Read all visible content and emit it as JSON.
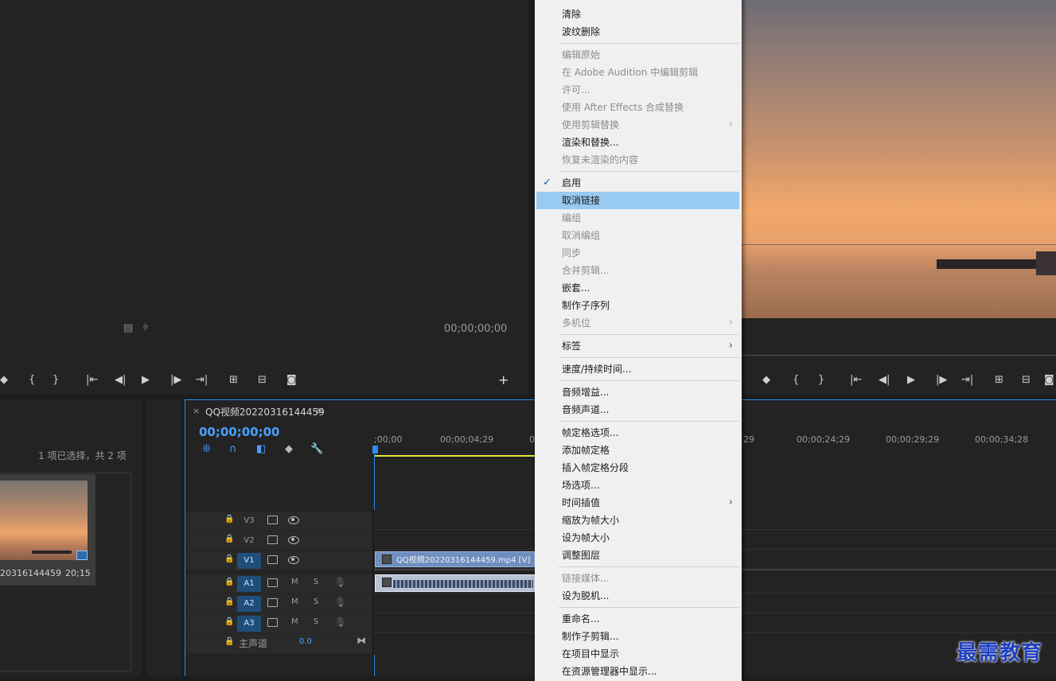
{
  "source_monitor": {
    "timecode": "00;00;00;00"
  },
  "project": {
    "selection_status": "1 项已选择，共 2 项",
    "clip_name": "20316144459",
    "clip_duration": "20;15"
  },
  "timeline": {
    "close_glyph": "×",
    "sequence_tab": "QQ视频20220316144459",
    "menu_glyph": "≡",
    "timecode": "00;00;00;00",
    "ruler_labels": [
      ";00;00",
      "00;00;04;29",
      "0",
      "29",
      "00;00;24;29",
      "00;00;29;29",
      "00;00;34;28"
    ],
    "video_tracks": [
      "V3",
      "V2",
      "V1"
    ],
    "audio_tracks": [
      "A1",
      "A2",
      "A3"
    ],
    "mute_label": "M",
    "solo_label": "S",
    "master_label": "主声道",
    "master_value": "0.0",
    "video_clip_label": "QQ视频20220316144459.mp4 [V]"
  },
  "context_menu": {
    "items": [
      {
        "label": "清除",
        "disabled": false
      },
      {
        "label": "波纹删除",
        "disabled": false
      },
      {
        "label": "编辑原始",
        "disabled": true
      },
      {
        "label": "在 Adobe Audition 中编辑剪辑",
        "disabled": true
      },
      {
        "label": "许可...",
        "disabled": true
      },
      {
        "label": "使用 After Effects 合成替换",
        "disabled": true
      },
      {
        "label": "使用剪辑替换",
        "disabled": true,
        "submenu": true
      },
      {
        "label": "渲染和替换...",
        "disabled": false
      },
      {
        "label": "恢复未渲染的内容",
        "disabled": true
      },
      {
        "label": "启用",
        "disabled": false,
        "checked": true
      },
      {
        "label": "取消链接",
        "disabled": false,
        "highlighted": true
      },
      {
        "label": "编组",
        "disabled": true
      },
      {
        "label": "取消编组",
        "disabled": true
      },
      {
        "label": "同步",
        "disabled": true
      },
      {
        "label": "合并剪辑...",
        "disabled": true
      },
      {
        "label": "嵌套...",
        "disabled": false
      },
      {
        "label": "制作子序列",
        "disabled": false
      },
      {
        "label": "多机位",
        "disabled": true,
        "submenu": true
      },
      {
        "label": "标签",
        "disabled": false,
        "submenu": true
      },
      {
        "label": "速度/持续时间...",
        "disabled": false
      },
      {
        "label": "音频增益...",
        "disabled": false
      },
      {
        "label": "音频声道...",
        "disabled": false
      },
      {
        "label": "帧定格选项...",
        "disabled": false
      },
      {
        "label": "添加帧定格",
        "disabled": false
      },
      {
        "label": "插入帧定格分段",
        "disabled": false
      },
      {
        "label": "场选项...",
        "disabled": false
      },
      {
        "label": "时间插值",
        "disabled": false,
        "submenu": true
      },
      {
        "label": "缩放为帧大小",
        "disabled": false
      },
      {
        "label": "设为帧大小",
        "disabled": false
      },
      {
        "label": "调整图层",
        "disabled": false
      },
      {
        "label": "链接媒体...",
        "disabled": true
      },
      {
        "label": "设为脱机...",
        "disabled": false
      },
      {
        "label": "重命名...",
        "disabled": false
      },
      {
        "label": "制作子剪辑...",
        "disabled": false
      },
      {
        "label": "在项目中显示",
        "disabled": false
      },
      {
        "label": "在资源管理器中显示...",
        "disabled": false
      }
    ],
    "submenu_glyph": "›",
    "check_glyph": "✓"
  },
  "watermark": "最需教育",
  "colors": {
    "accent_blue": "#2d8ceb",
    "highlight": "#99cbf2",
    "clip_blue": "#6e8fbf",
    "playhead": "#2d8ceb"
  }
}
